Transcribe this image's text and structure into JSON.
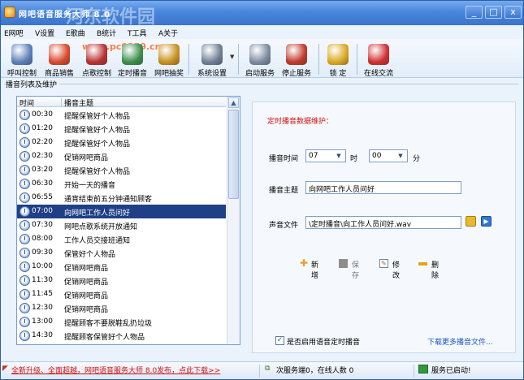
{
  "window": {
    "title": "网吧语音服务大师 8.0",
    "watermark": "河东软件园",
    "watermark_url": "www.pc0359.cn",
    "controls": [
      "_",
      "□",
      "x"
    ]
  },
  "menu": [
    "E网吧",
    "V设置",
    "E歌曲",
    "B统计",
    "T工具",
    "A关于"
  ],
  "toolbar": [
    {
      "label": "呼叫控制",
      "icon": "speaker-icon",
      "color": "#5a7fb8"
    },
    {
      "label": "商品销售",
      "icon": "products-icon",
      "color": "#d8482a"
    },
    {
      "label": "点歌控制",
      "icon": "music-disc-icon",
      "color": "#b83232"
    },
    {
      "label": "定时播音",
      "icon": "clock-icon",
      "color": "#3b8f4a"
    },
    {
      "label": "网吧抽奖",
      "icon": "gift-icon",
      "color": "#c8901e"
    },
    {
      "label": "系统设置",
      "icon": "tools-icon",
      "color": "#6f7f94"
    },
    {
      "label": "启动服务",
      "icon": "start-service-icon",
      "color": "#7c8aa0"
    },
    {
      "label": "停止服务",
      "icon": "stop-service-icon",
      "color": "#c03a2b"
    },
    {
      "label": "锁 定",
      "icon": "key-icon",
      "color": "#d9a820"
    },
    {
      "label": "在线交流",
      "icon": "chat-icon",
      "color": "#d03030"
    }
  ],
  "group_title": "播音列表及维护",
  "list": {
    "columns": [
      "时间",
      "播音主题"
    ],
    "rows": [
      {
        "time": "00:30",
        "topic": "提醒保管好个人物品"
      },
      {
        "time": "01:20",
        "topic": "提醒保管好个人物品"
      },
      {
        "time": "02:20",
        "topic": "提醒保管好个人物品"
      },
      {
        "time": "02:30",
        "topic": "促销网吧商品"
      },
      {
        "time": "03:20",
        "topic": "提醒保管好个人物品"
      },
      {
        "time": "06:30",
        "topic": "开始一天的播音"
      },
      {
        "time": "06:55",
        "topic": "通宵结束前五分钟通知顾客"
      },
      {
        "time": "07:00",
        "topic": "向网吧工作人员问好"
      },
      {
        "time": "07:30",
        "topic": "网吧点歌系统开放通知"
      },
      {
        "time": "08:00",
        "topic": "工作人员交接班通知"
      },
      {
        "time": "09:30",
        "topic": "保管好个人物品"
      },
      {
        "time": "10:00",
        "topic": "促销网吧商品"
      },
      {
        "time": "11:30",
        "topic": "促销网吧商品"
      },
      {
        "time": "11:45",
        "topic": "促销网吧商品"
      },
      {
        "time": "12:30",
        "topic": "促销网吧商品"
      },
      {
        "time": "13:00",
        "topic": "提醒顾客不要脱鞋乱扔垃圾"
      },
      {
        "time": "14:30",
        "topic": "提醒顾客保管好个人物品"
      }
    ],
    "selected_index": 7
  },
  "form": {
    "title": "定时播音数据维护：",
    "time_label": "播音时间",
    "hour": "07",
    "hour_unit": "时",
    "minute": "00",
    "minute_unit": "分",
    "topic_label": "播音主题",
    "topic_value": "向网吧工作人员问好",
    "file_label": "声音文件",
    "file_value": "\\定时播音\\向工作人员问好.wav",
    "actions": [
      "新增",
      "保存",
      "修改",
      "删除"
    ],
    "enable_label": "是否启用语音定时播音",
    "enabled": true,
    "download_link": "下载更多播音文件..."
  },
  "status": {
    "news": "全新升级、全面超越，网吧语音服务大师 8.0发布，点此下载>>",
    "connections": "次服务端0，在线人数 0",
    "service_state": "服务已启动!"
  }
}
